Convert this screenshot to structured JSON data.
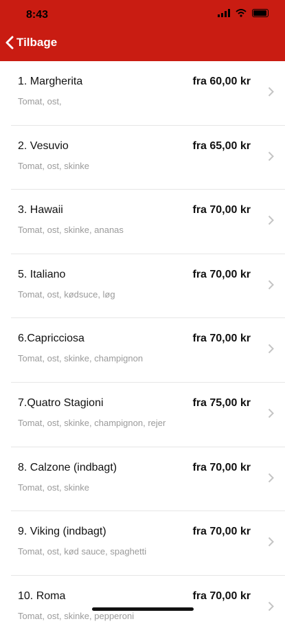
{
  "status": {
    "time": "8:43"
  },
  "nav": {
    "back_label": "Tilbage"
  },
  "items": [
    {
      "name": "1. Margherita",
      "desc": "Tomat, ost,",
      "price": "fra 60,00 kr"
    },
    {
      "name": "2. Vesuvio",
      "desc": "Tomat, ost, skinke",
      "price": "fra 65,00 kr"
    },
    {
      "name": "3. Hawaii",
      "desc": "Tomat, ost, skinke, ananas",
      "price": "fra 70,00 kr"
    },
    {
      "name": "5. Italiano",
      "desc": "Tomat, ost, kødsuce, løg",
      "price": "fra 70,00 kr"
    },
    {
      "name": "6.Capricciosa",
      "desc": "Tomat, ost, skinke, champignon",
      "price": "fra 70,00 kr"
    },
    {
      "name": "7.Quatro Stagioni",
      "desc": "Tomat, ost, skinke, champignon, rejer",
      "price": "fra 75,00 kr"
    },
    {
      "name": "8. Calzone (indbagt)",
      "desc": "Tomat, ost, skinke",
      "price": "fra 70,00 kr"
    },
    {
      "name": "9. Viking (indbagt)",
      "desc": "Tomat, ost, kød sauce, spaghetti",
      "price": "fra 70,00 kr"
    },
    {
      "name": "10. Roma",
      "desc": "Tomat, ost, skinke, pepperoni",
      "price": "fra 70,00 kr"
    }
  ]
}
